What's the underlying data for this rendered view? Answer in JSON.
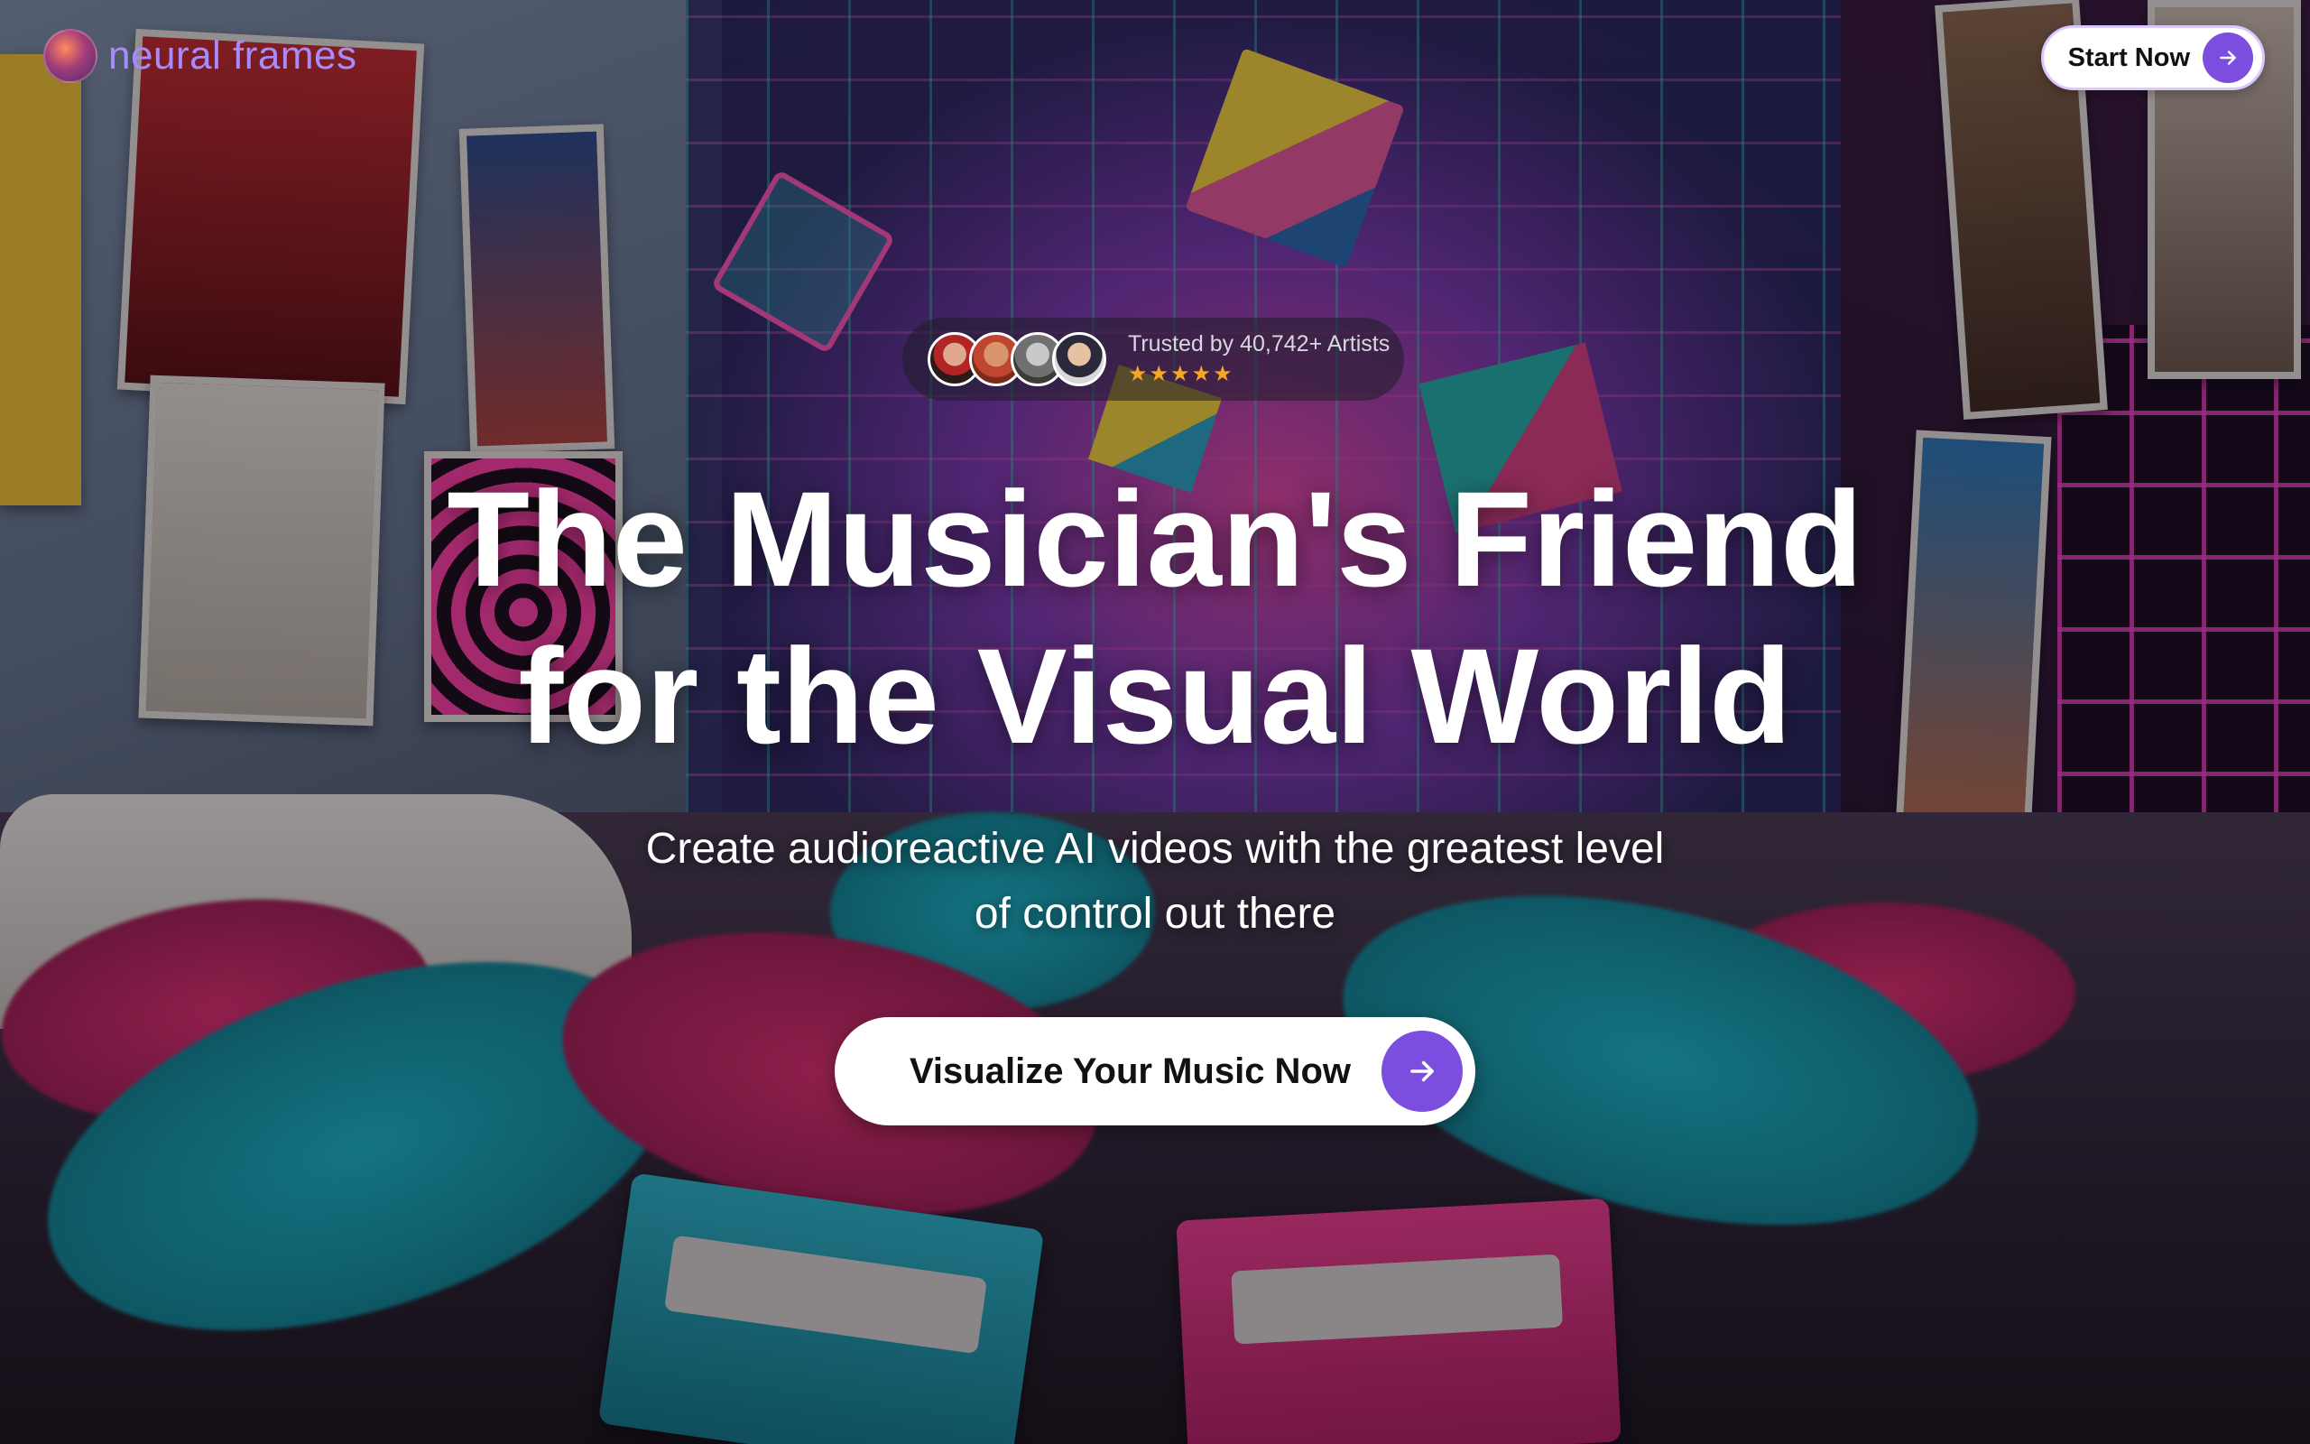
{
  "brand": {
    "name": "neural frames",
    "logo_icon": "neural-frames-logo",
    "accent_color": "#7c4ee0",
    "brand_text_color": "#a78bfa"
  },
  "header": {
    "start_button": {
      "label": "Start Now",
      "icon": "arrow-right-icon"
    }
  },
  "trust_badge": {
    "label": "Trusted by 40,742+ Artists",
    "stars": "★★★★★",
    "rating_stars": 5,
    "avatar_count": 4
  },
  "hero": {
    "headline_line1": "The Musician's Friend",
    "headline_line2": "for the Visual World",
    "subheadline_line1": "Create audioreactive AI videos with the greatest level",
    "subheadline_line2": "of control out there",
    "cta": {
      "label": "Visualize Your Music Now",
      "icon": "arrow-right-icon"
    }
  }
}
